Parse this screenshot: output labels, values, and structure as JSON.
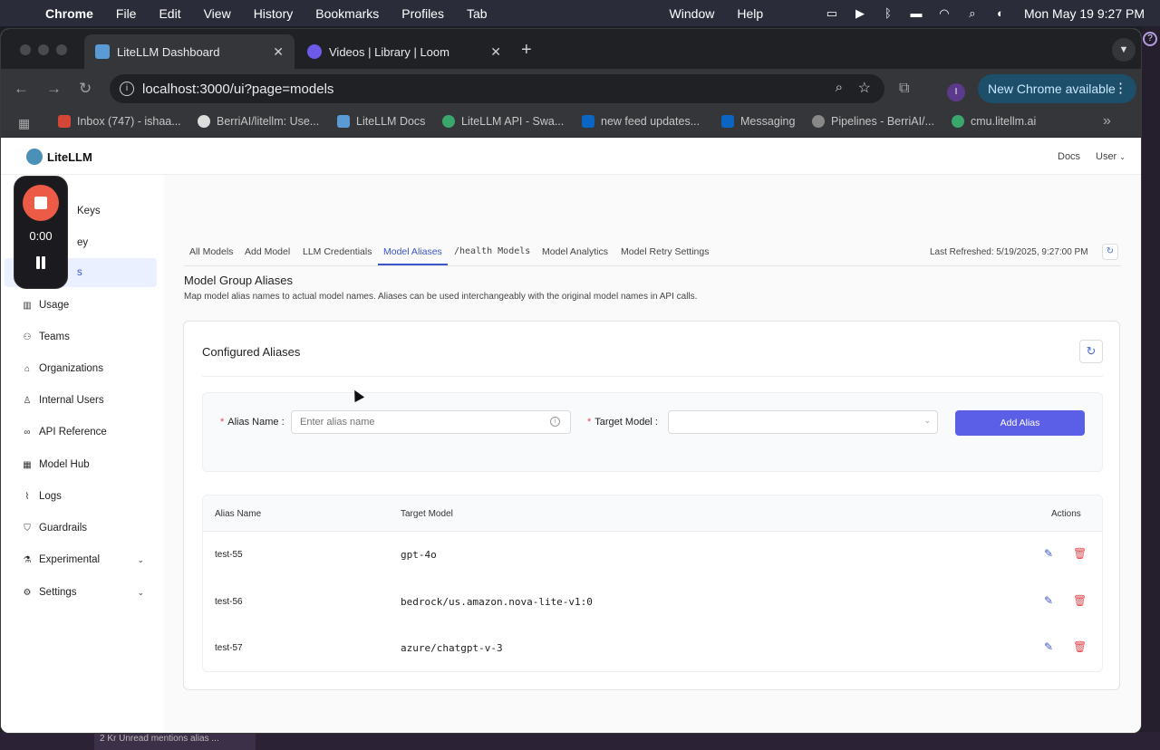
{
  "menubar": {
    "app": "Chrome",
    "items": [
      "File",
      "Edit",
      "View",
      "History",
      "Bookmarks",
      "Profiles",
      "Tab"
    ],
    "right_items": [
      "Window",
      "Help"
    ],
    "clock": "Mon May 19  9:27 PM"
  },
  "browser": {
    "tabs": [
      {
        "title": "LiteLLM Dashboard",
        "close": "✕"
      },
      {
        "title": "Videos | Library | Loom",
        "close": "✕"
      }
    ],
    "new_tab": "+",
    "url": "localhost:3000/ui?page=models",
    "profile_initial": "I",
    "new_chrome": "New Chrome available",
    "bookmarks": [
      "Inbox (747) - ishaa...",
      "BerriAI/litellm: Use...",
      "LiteLLM Docs",
      "LiteLLM API - Swa...",
      "new feed updates...",
      "Messaging",
      "Pipelines - BerriAI/...",
      "cmu.litellm.ai"
    ]
  },
  "desktop": {
    "task_text": "2  Kr  Unread mentions  alias ..."
  },
  "app": {
    "logo": "LiteLLM",
    "header": {
      "docs": "Docs",
      "user": "User"
    },
    "sidebar": [
      {
        "label": "Keys",
        "icon": "key-icon"
      },
      {
        "label": "ey",
        "icon": "key-icon"
      },
      {
        "label": "s",
        "icon": "models-icon"
      },
      {
        "label": "Usage",
        "icon": "chart-icon"
      },
      {
        "label": "Teams",
        "icon": "teams-icon"
      },
      {
        "label": "Organizations",
        "icon": "bank-icon"
      },
      {
        "label": "Internal Users",
        "icon": "user-icon"
      },
      {
        "label": "API Reference",
        "icon": "link-icon"
      },
      {
        "label": "Model Hub",
        "icon": "grid-icon"
      },
      {
        "label": "Logs",
        "icon": "line-chart-icon"
      },
      {
        "label": "Guardrails",
        "icon": "shield-icon"
      },
      {
        "label": "Experimental",
        "icon": "flask-icon"
      },
      {
        "label": "Settings",
        "icon": "gear-icon"
      }
    ],
    "loom": {
      "time": "0:00"
    },
    "tabs": [
      "All Models",
      "Add Model",
      "LLM Credentials",
      "Model Aliases",
      "/health Models",
      "Model Analytics",
      "Model Retry Settings"
    ],
    "last_refreshed": "Last Refreshed: 5/19/2025, 9:27:00 PM",
    "section_title": "Model Group Aliases",
    "section_desc": "Map model alias names to actual model names. Aliases can be used interchangeably with the original model names in API calls.",
    "card_title": "Configured Aliases",
    "form": {
      "alias_label": "Alias Name",
      "alias_placeholder": "Enter alias name",
      "target_label": "Target Model",
      "add_button": "Add Alias"
    },
    "table": {
      "headers": [
        "Alias Name",
        "Target Model",
        "Actions"
      ],
      "rows": [
        {
          "alias": "test-55",
          "target": "gpt-4o"
        },
        {
          "alias": "test-56",
          "target": "bedrock/us.amazon.nova-lite-v1:0"
        },
        {
          "alias": "test-57",
          "target": "azure/chatgpt-v-3"
        }
      ]
    }
  }
}
